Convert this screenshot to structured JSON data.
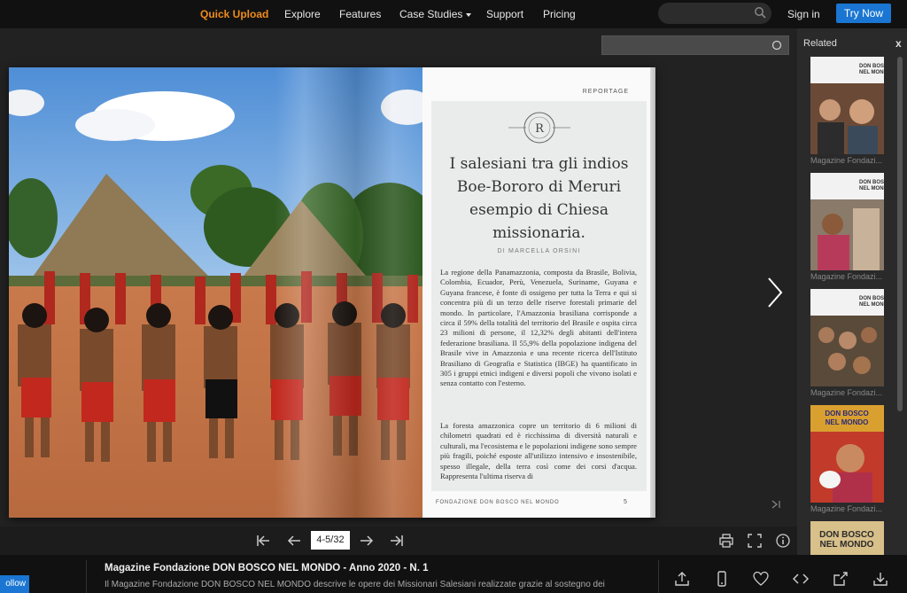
{
  "nav": {
    "quick_upload": "Quick Upload",
    "explore": "Explore",
    "features": "Features",
    "case_studies": "Case Studies",
    "support": "Support",
    "pricing": "Pricing",
    "sign_in": "Sign in",
    "try_now": "Try Now"
  },
  "article": {
    "section": "REPORTAGE",
    "logo_letter": "R",
    "headline_lines": [
      "I salesiani tra gli indios",
      "Boe-Bororo di Meruri",
      "esempio di Chiesa",
      "missionaria."
    ],
    "byline": "DI MARCELLA ORSINI",
    "paragraph1": "La regione della Panamazzonia, composta da Brasile, Bolivia, Colombia, Ecuador, Perù, Venezuela, Suriname, Guyana e Guyana francese, è fonte di ossigeno per tutta la Terra e qui si concentra più di un terzo delle riserve forestali primarie del mondo. In particolare, l'Amazzonia brasiliana corrisponde a circa il 59% della totalità del territorio del Brasile e ospita circa 23 milioni di persone, il 12,32% degli abitanti dell'intera federazione brasiliana. Il 55,9% della popolazione indigena del Brasile vive in Amazzonia e una recente ricerca dell'Istituto Brasiliano di Geografia e Statistica (IBGE) ha quantificato in 305 i gruppi etnici indigeni e diversi popoli che vivono isolati e senza contatto con l'esterno.",
    "paragraph2": "La foresta amazzonica copre un territorio di 6 milioni di chilometri quadrati ed è ricchissima di diversità naturali e culturali, ma l'ecosistema e le popolazioni indigene sono sempre più fragili, poiché esposte all'utilizzo intensivo e insostenibile, spesso illegale, della terra così come dei corsi d'acqua. Rappresenta l'ultima riserva di",
    "footer_left": "FONDAZIONE DON BOSCO NEL MONDO",
    "page_number": "5"
  },
  "controls": {
    "page_indicator": "4-5/32"
  },
  "related": {
    "title": "Related",
    "close": "x",
    "items": [
      {
        "caption": "Magazine Fondazi..."
      },
      {
        "caption": "Magazine Fondazi..."
      },
      {
        "caption": "Magazine Fondazi..."
      },
      {
        "caption": "Magazine Fondazi..."
      }
    ],
    "masthead_line1": "DON BOSCO",
    "masthead_line2": "NEL MONDO"
  },
  "info": {
    "follow": "ollow",
    "title": "Magazine Fondazione DON BOSCO NEL MONDO - Anno 2020 - N. 1",
    "description": "Il Magazine Fondazione DON BOSCO NEL MONDO descrive le opere dei Missionari Salesiani realizzate grazie al sostegno dei"
  },
  "colors": {
    "accent_orange": "#f08c1a",
    "brand_blue": "#1a76d2",
    "background": "#1c1c1c"
  }
}
